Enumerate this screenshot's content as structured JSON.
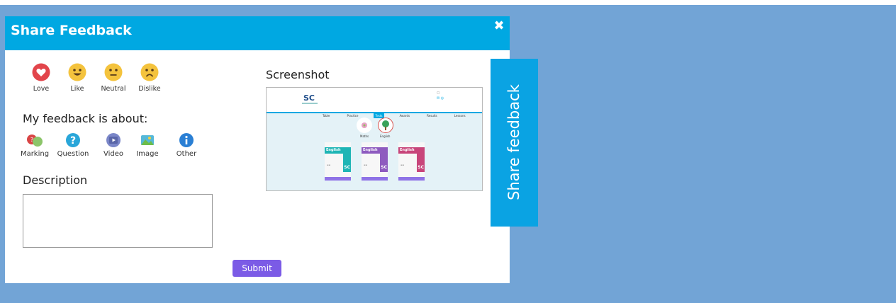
{
  "modal": {
    "title": "Share Feedback",
    "close_icon": "close-x-icon",
    "header_color": "#00a8e2"
  },
  "reactions": [
    {
      "label": "Love",
      "icon": "heart-icon",
      "color": "#e2454b"
    },
    {
      "label": "Like",
      "icon": "smile-emoji-icon",
      "color": "#f4c33d"
    },
    {
      "label": "Neutral",
      "icon": "neutral-emoji-icon",
      "color": "#f4c33d"
    },
    {
      "label": "Dislike",
      "icon": "frown-emoji-icon",
      "color": "#f4c33d"
    }
  ],
  "feedback_about": {
    "heading": "My feedback is about:",
    "topics": [
      {
        "label": "Marking",
        "icon": "marking-icon"
      },
      {
        "label": "Question",
        "icon": "question-icon"
      },
      {
        "label": "Video",
        "icon": "video-icon"
      },
      {
        "label": "Image",
        "icon": "image-icon"
      },
      {
        "label": "Other",
        "icon": "info-icon"
      }
    ]
  },
  "description": {
    "heading": "Description",
    "value": ""
  },
  "submit_label": "Submit",
  "screenshot": {
    "heading": "Screenshot",
    "thumb": {
      "logo": "SC",
      "nav": [
        "Table",
        "Practice",
        "Tests",
        "Awards",
        "Results",
        "Lessons"
      ],
      "active_nav": "Tests",
      "subjects": [
        "Maths",
        "English"
      ],
      "book_title": "English"
    }
  },
  "side_tab_label": "Share feedback",
  "colors": {
    "backdrop": "#72a4d6",
    "accent": "#00a8e2",
    "submit": "#7b5be6"
  }
}
